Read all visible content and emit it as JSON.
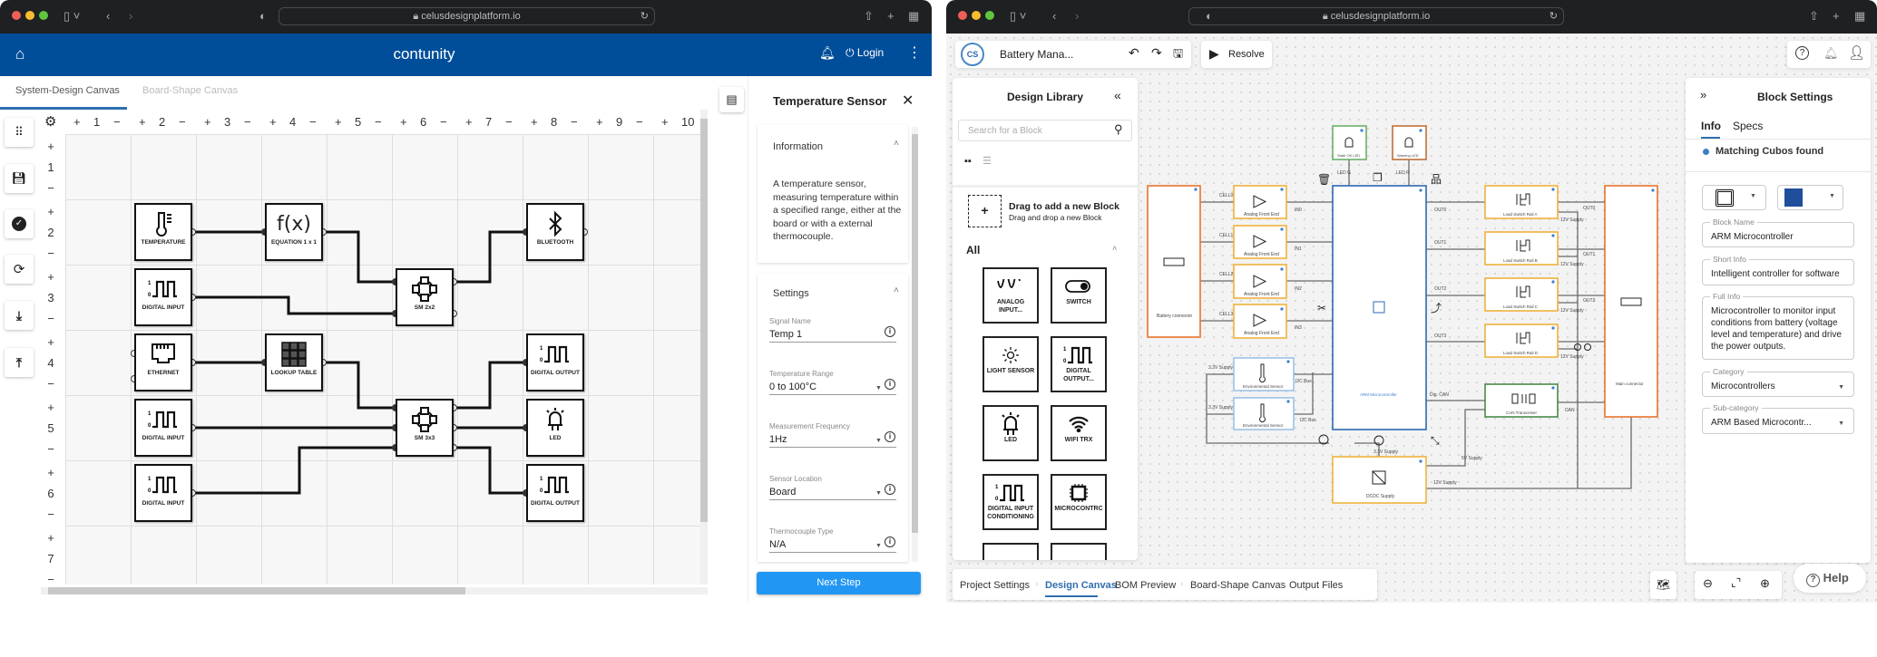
{
  "left_window": {
    "browser": {
      "url": "celusdesignplatform.io"
    },
    "header": {
      "title": "contunity",
      "login": "Login"
    },
    "tabs": [
      {
        "label": "System-Design Canvas",
        "active": true
      },
      {
        "label": "Board-Shape Canvas",
        "active": false
      }
    ],
    "canvas": {
      "plus": "+",
      "minus": "−",
      "columns": [
        "1",
        "2",
        "3",
        "4",
        "5",
        "6",
        "7",
        "8",
        "9",
        "10"
      ],
      "rows": [
        "1",
        "2",
        "3",
        "4",
        "5",
        "6",
        "7"
      ],
      "blocks": [
        {
          "label": "TEMPERATURE",
          "icon": "thermometer-icon"
        },
        {
          "label": "EQUATION 1 x 1",
          "icon": "function-icon",
          "icon_text": "f(x)"
        },
        {
          "label": "BLUETOOTH",
          "icon": "bluetooth-icon"
        },
        {
          "label": "DIGITAL INPUT",
          "icon": "digital-signal-icon"
        },
        {
          "label": "SM 2x2",
          "icon": "state-machine-icon"
        },
        {
          "label": "ETHERNET",
          "icon": "ethernet-icon"
        },
        {
          "label": "LOOKUP TABLE",
          "icon": "table-grid-icon"
        },
        {
          "label": "DIGITAL OUTPUT",
          "icon": "digital-signal-icon"
        },
        {
          "label": "DIGITAL INPUT",
          "icon": "digital-signal-icon"
        },
        {
          "label": "SM 3x3",
          "icon": "state-machine-icon"
        },
        {
          "label": "LED",
          "icon": "led-icon"
        },
        {
          "label": "DIGITAL INPUT",
          "icon": "digital-signal-icon"
        },
        {
          "label": "DIGITAL OUTPUT",
          "icon": "digital-signal-icon"
        }
      ]
    },
    "panel": {
      "title": "Temperature Sensor",
      "information": {
        "heading": "Information",
        "text": "A temperature sensor, measuring temperature within a specified range, either at the board or with a external thermocouple."
      },
      "settings": {
        "heading": "Settings",
        "fields": [
          {
            "label": "Signal Name",
            "value": "Temp 1",
            "type": "text"
          },
          {
            "label": "Temperature Range",
            "value": "0 to 100°C",
            "type": "select"
          },
          {
            "label": "Measurement Frequency",
            "value": "1Hz",
            "type": "select"
          },
          {
            "label": "Sensor Location",
            "value": "Board",
            "type": "select"
          },
          {
            "label": "Thermocouple Type",
            "value": "N/A",
            "type": "select"
          }
        ]
      },
      "next_step": "Next Step"
    },
    "colors": {
      "header": "#004e9a",
      "accent": "#1e90ff"
    }
  },
  "right_window": {
    "browser": {
      "url": "celusdesignplatform.io"
    },
    "toolbar": {
      "logo_text": "CS",
      "project": "Battery Mana...",
      "resolve": "Resolve"
    },
    "library": {
      "title": "Design Library",
      "search_placeholder": "Search for a Block",
      "drag_title": "Drag to add a new Block",
      "drag_subtitle": "Drag and drop a new Block",
      "section": "All",
      "blocks": [
        {
          "label": "ANALOG INPUT...",
          "icon": "analog-wave-icon"
        },
        {
          "label": "SWITCH",
          "icon": "toggle-switch-icon"
        },
        {
          "label": "LIGHT SENSOR",
          "icon": "sun-icon"
        },
        {
          "label": "DIGITAL OUTPUT...",
          "icon": "digital-signal-icon"
        },
        {
          "label": "LED",
          "icon": "led-icon"
        },
        {
          "label": "WIFI TRX",
          "icon": "wifi-icon"
        },
        {
          "label": "DIGITAL INPUT CONDITIONING",
          "icon": "digital-signal-icon"
        },
        {
          "label": "MICROCONTRC",
          "icon": "chip-icon"
        }
      ]
    },
    "schematic": {
      "battery": "Battery connector",
      "afe": "Analog Front End",
      "cells": [
        "CELL0",
        "CELL1",
        "CELL2",
        "CELL3"
      ],
      "inputs": [
        "IN0",
        "IN1",
        "IN2",
        "IN3"
      ],
      "state_led": "State OK LED",
      "warning_led": "Warning LED",
      "led_g": "LED G",
      "led_r": "LED R",
      "mcu": "ARM Microcontroller",
      "env": "Environmental Sensor",
      "supply_33": "3.3V Supply",
      "i2c": "I2C Bus",
      "dcdc": "DCDC Supply",
      "supply_12": "12V Supply",
      "supply_5": "5V Supply",
      "load_switches": [
        "Load Switch Rail A",
        "Load Switch Rail B",
        "Load Switch Rail C",
        "Load Switch Rail D"
      ],
      "outputs": [
        "OUT0",
        "OUT1",
        "OUT2",
        "OUT3"
      ],
      "main": "Main connector",
      "can": "CAN Transceiver",
      "dig_can": "Dig. CAN",
      "can_net": "CAN"
    },
    "block_settings": {
      "title": "Block Settings",
      "tabs": [
        {
          "label": "Info",
          "active": true
        },
        {
          "label": "Specs",
          "active": false
        }
      ],
      "status": "Matching Cubos found",
      "block_color": "#1f4f9a",
      "fields": [
        {
          "label": "Block Name",
          "value": "ARM Microcontroller"
        },
        {
          "label": "Short Info",
          "value": "Intelligent controller for software"
        },
        {
          "label": "Full Info",
          "value": "Microcontroller to monitor input conditions from battery (voltage level and temperature) and drive the power outputs."
        },
        {
          "label": "Category",
          "value": "Microcontrollers",
          "type": "select"
        },
        {
          "label": "Sub-category",
          "value": "ARM Based Microcontr...",
          "type": "select"
        }
      ]
    },
    "bottom_tabs": [
      {
        "label": "Project Settings"
      },
      {
        "label": "Design Canvas",
        "active": true
      },
      {
        "label": "BOM Preview"
      },
      {
        "label": "Board-Shape Canvas"
      },
      {
        "label": "Output Files"
      }
    ],
    "help": "Help"
  }
}
